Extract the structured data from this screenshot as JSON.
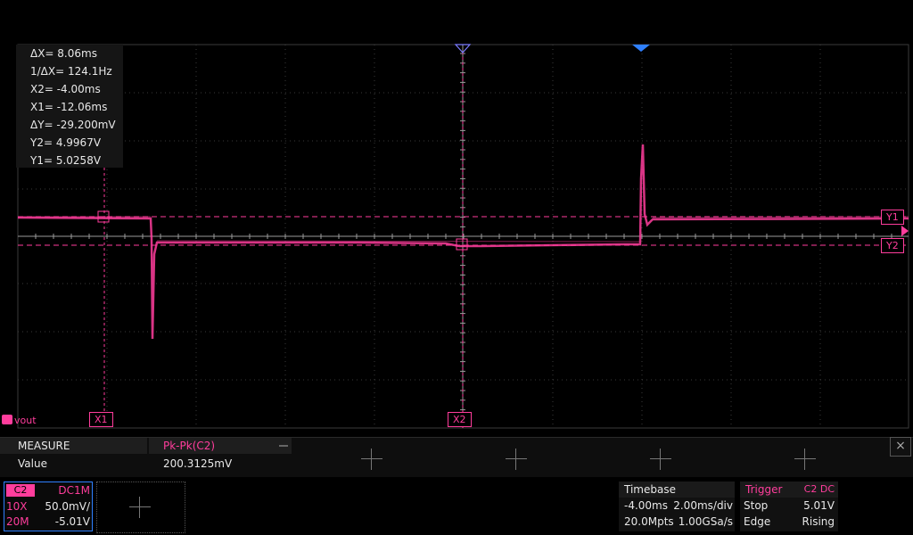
{
  "cursor_readout": {
    "delta_x": "ΔX= 8.06ms",
    "inv_delta_x": "1/ΔX= 124.1Hz",
    "x2": "X2= -4.00ms",
    "x1": "X1= -12.06ms",
    "delta_y": "ΔY= -29.200mV",
    "y2": "Y2= 4.9967V",
    "y1": "Y1= 5.0258V"
  },
  "markers": {
    "x1": "X1",
    "x2": "X2",
    "y1": "Y1",
    "y2": "Y2"
  },
  "channel_label": "vout",
  "measure": {
    "header_label": "MEASURE",
    "value_label": "Value",
    "item_name": "Pk-Pk(C2)",
    "item_value": "200.3125mV",
    "close_icon": "×"
  },
  "channel": {
    "name": "C2",
    "coupling": "DC1M",
    "probe": "10X",
    "scale": "50.0mV/",
    "bandwidth": "20M",
    "offset": "-5.01V"
  },
  "timebase": {
    "title": "Timebase",
    "delay": "-4.00ms",
    "scale": "2.00ms/div",
    "memory": "20.0Mpts",
    "sample_rate": "1.00GSa/s"
  },
  "trigger": {
    "title": "Trigger",
    "source": "C2 DC",
    "mode": "Stop",
    "level": "5.01V",
    "type": "Edge",
    "slope": "Rising"
  },
  "colors": {
    "trace": "#ff3d9c",
    "accent_blue": "#2f80ff",
    "grid": "#3a3a3a"
  }
}
